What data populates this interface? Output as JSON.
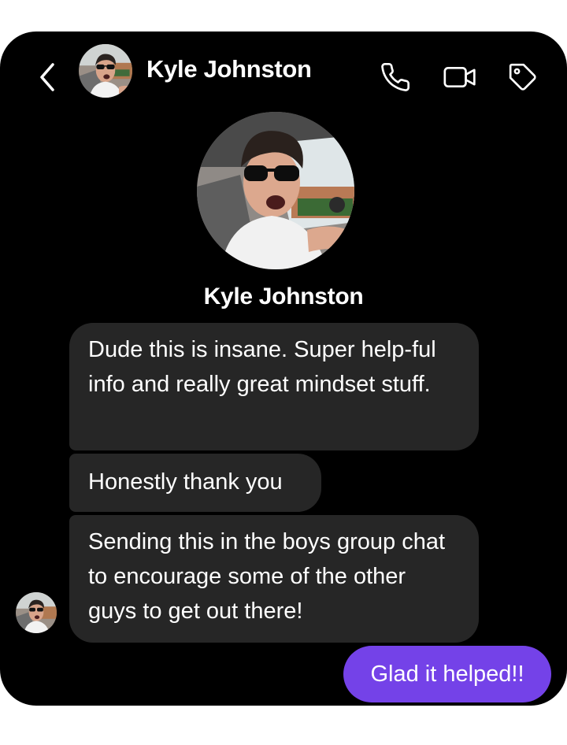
{
  "conversation": {
    "contact_name": "Kyle Johnston",
    "profile_name": "Kyle Johnston"
  },
  "header": {
    "back_icon": "chevron-left-icon",
    "call_icon": "phone-icon",
    "video_icon": "video-camera-icon",
    "tag_icon": "tag-icon"
  },
  "messages": [
    {
      "from": "contact",
      "text": "Dude this is insane. Super help-ful info and really great mindset stuff."
    },
    {
      "from": "contact",
      "text": "Honestly thank you"
    },
    {
      "from": "contact",
      "text": "Sending this in the boys group chat to encourage some of the other guys to get out there!"
    },
    {
      "from": "me",
      "text": "Glad it helped!!"
    }
  ],
  "colors": {
    "background": "#000000",
    "incoming_bubble": "#262626",
    "outgoing_bubble": "#7442e8",
    "text": "#ffffff"
  }
}
